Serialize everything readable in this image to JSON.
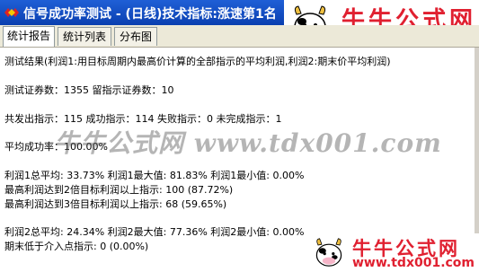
{
  "window": {
    "title": "信号成功率测试 - (日线)技术指标:涨速第1名"
  },
  "tabs": [
    {
      "label": "统计报告",
      "active": true
    },
    {
      "label": "统计列表",
      "active": false
    },
    {
      "label": "分布图",
      "active": false
    }
  ],
  "report": {
    "lines": [
      "测试结果(利润1:用目标周期内最高价计算的全部指示的平均利润,利润2:期末价平均利润)",
      "测试证券数：1355          留指示证券数：10",
      "共发出指示：115   成功指示：114   失败指示：0   未完成指示：1",
      "平均成功率：100.00%",
      "利润1总平均: 33.73%  利润1最大值: 81.83%  利润1最小值: 0.00%",
      "最高利润达到2倍目标利润以上指示: 100 (87.72%)",
      "最高利润达到3倍目标利润以上指示: 68 (59.65%)",
      "利润2总平均: 24.34%  利润2最大值: 77.36%  利润2最小值: 0.00%",
      "期末低于介入点指示: 0 (0.00%)"
    ]
  },
  "watermark": {
    "text": "牛牛公式网 www.tdx001.com"
  },
  "brand": {
    "name": "牛牛公式网",
    "url": "www.tdx001.com",
    "color": "#e02030"
  },
  "colors": {
    "titlebar": "#0a3fb0",
    "window": "#ece9d8"
  }
}
